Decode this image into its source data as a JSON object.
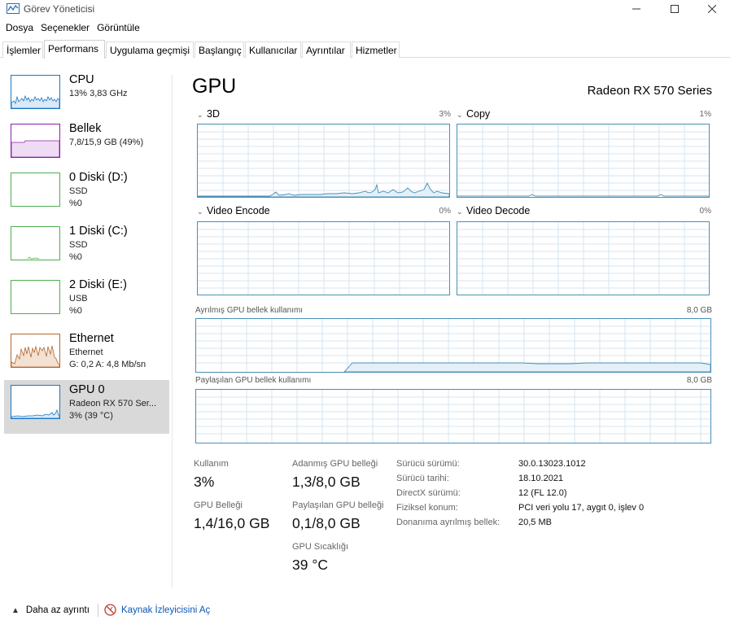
{
  "window": {
    "title": "Görev Yöneticisi"
  },
  "menu": [
    "Dosya",
    "Seçenekler",
    "Görüntüle"
  ],
  "tabs": [
    "İşlemler",
    "Performans",
    "Uygulama geçmişi",
    "Başlangıç",
    "Kullanıcılar",
    "Ayrıntılar",
    "Hizmetler"
  ],
  "active_tab": "Performans",
  "sidebar": {
    "items": [
      {
        "name": "CPU",
        "sub1": "13%  3,83 GHz",
        "sub2": "",
        "color": "#1976c8",
        "icon": "cpu-graph"
      },
      {
        "name": "Bellek",
        "sub1": "7,8/15,9 GB (49%)",
        "sub2": "",
        "color": "#8b1fa9",
        "icon": "memory-graph"
      },
      {
        "name": "0 Diski (D:)",
        "sub1": "SSD",
        "sub2": "%0",
        "color": "#4caf50",
        "icon": "disk-graph"
      },
      {
        "name": "1 Diski (C:)",
        "sub1": "SSD",
        "sub2": "%0",
        "color": "#4caf50",
        "icon": "disk-graph"
      },
      {
        "name": "2 Diski (E:)",
        "sub1": "USB",
        "sub2": "%0",
        "color": "#4caf50",
        "icon": "disk-graph"
      },
      {
        "name": "Ethernet",
        "sub1": "Ethernet",
        "sub2": "G: 0,2  A: 4,8 Mb/sn",
        "color": "#b4662a",
        "icon": "ethernet-graph"
      },
      {
        "name": "GPU 0",
        "sub1": "Radeon RX 570 Ser...",
        "sub2": "3% (39 °C)",
        "color": "#1976c8",
        "icon": "gpu-graph"
      }
    ],
    "selected": "GPU 0"
  },
  "main": {
    "title": "GPU",
    "device": "Radeon RX 570 Series",
    "engines": [
      {
        "label": "3D",
        "pct": "3%"
      },
      {
        "label": "Copy",
        "pct": "1%"
      },
      {
        "label": "Video Encode",
        "pct": "0%"
      },
      {
        "label": "Video Decode",
        "pct": "0%"
      }
    ],
    "dedicated": {
      "label": "Ayrılmış GPU bellek kullanımı",
      "max": "8,0 GB"
    },
    "shared": {
      "label": "Paylaşılan GPU bellek kullanımı",
      "max": "8,0 GB"
    },
    "stats": {
      "usage_label": "Kullanım",
      "usage_value": "3%",
      "gpu_mem_label": "GPU Belleği",
      "gpu_mem_value": "1,4/16,0 GB",
      "dedicated_label": "Adanmış GPU belleği",
      "dedicated_value": "1,3/8,0 GB",
      "shared_label": "Paylaşılan GPU belleği",
      "shared_value": "0,1/8,0 GB",
      "temp_label": "GPU Sıcaklığı",
      "temp_value": "39 °C"
    },
    "details": [
      {
        "k": "Sürücü sürümü:",
        "v": "30.0.13023.1012"
      },
      {
        "k": "Sürücü tarihi:",
        "v": "18.10.2021"
      },
      {
        "k": "DirectX sürümü:",
        "v": "12 (FL 12.0)"
      },
      {
        "k": "Fiziksel konum:",
        "v": "PCI veri yolu 17, aygıt 0, işlev 0"
      },
      {
        "k": "Donanıma ayrılmış bellek:",
        "v": "20,5 MB"
      }
    ]
  },
  "footer": {
    "fewer_details": "Daha az ayrıntı",
    "resource_monitor": "Kaynak İzleyicisini Aç"
  },
  "colors": {
    "accent": "#1976c8",
    "graph_border": "#4a8fb7",
    "link": "#0b57b5"
  }
}
